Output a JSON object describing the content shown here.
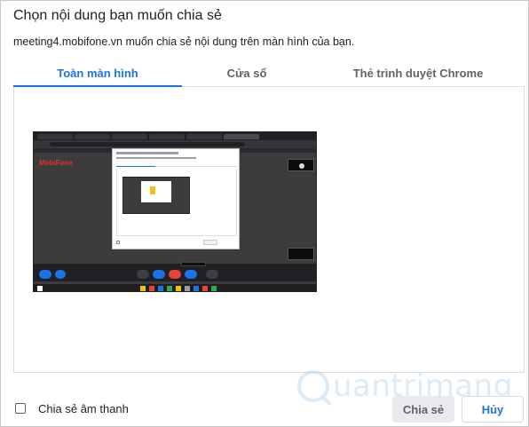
{
  "dialog": {
    "title": "Chọn nội dung bạn muốn chia sẻ",
    "subtitle": "meeting4.mobifone.vn muốn chia sẻ nội dung trên màn hình của bạn."
  },
  "tabs": [
    {
      "label": "Toàn màn hình",
      "active": true
    },
    {
      "label": "Cửa sổ",
      "active": false
    },
    {
      "label": "Thẻ trình duyệt Chrome",
      "active": false
    }
  ],
  "preview": {
    "logo_text": "MobiFone",
    "icon": "screen-preview-thumbnail"
  },
  "footer": {
    "share_audio_label": "Chia sẻ âm thanh",
    "share_audio_checked": false,
    "share_button": "Chia sẻ",
    "cancel_button": "Hủy"
  },
  "watermark": {
    "text": "uantrimang"
  },
  "colors": {
    "accent": "#1a73e8",
    "disabled_button_bg": "#e8eaed",
    "meet_dark": "#3c3c3c"
  }
}
